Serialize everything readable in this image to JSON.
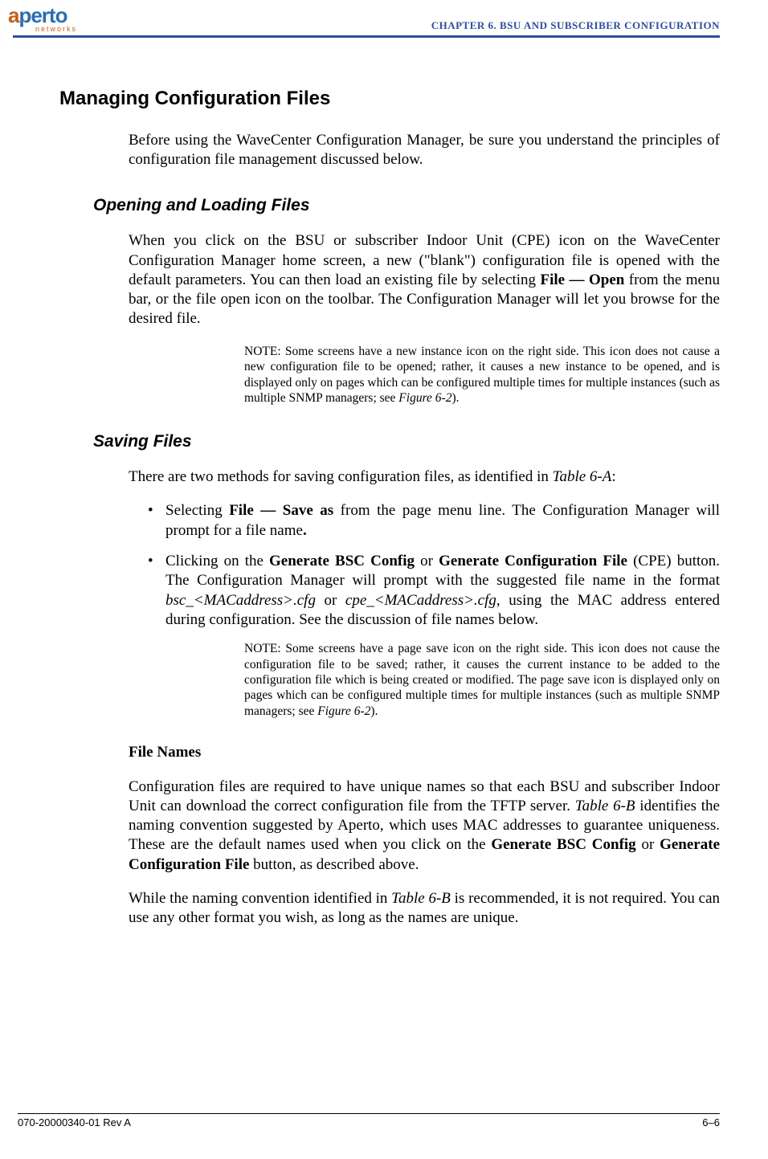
{
  "header": {
    "logo_primary": "a",
    "logo_rest": "perto",
    "logo_sub": "networks",
    "chapter_label": "CHAPTER 6.  BSU AND SUBSCRIBER CONFIGURATION"
  },
  "section": {
    "title": "Managing Configuration Files",
    "intro": "Before using the WaveCenter Configuration Manager, be sure you understand the principles of configuration file management discussed below."
  },
  "opening": {
    "heading": "Opening and Loading Files",
    "para_pre": "When you click on the BSU or subscriber Indoor Unit (CPE) icon on the WaveCenter Configuration Manager home screen, a new (\"blank\") configuration file is opened with the default parameters. You can then load an existing file by selecting ",
    "file_open": "File — Open",
    "para_post": " from the menu bar, or the file open icon on the toolbar. The Configuration Man­ager will let you browse for the desired file.",
    "note_pre": "NOTE:  Some screens have a new instance icon on the right side. This icon does not cause a new configuration file to be opened; rather, it causes a new instance to be opened, and is displayed only on pages which can be configured multiple times for multiple instances (such as multiple SNMP managers; see ",
    "note_ref": "Figure 6-2",
    "note_post": ")."
  },
  "saving": {
    "heading": "Saving Files",
    "intro_pre": "There are two methods for saving configuration files, as identified in ",
    "intro_ref": "Table 6-A",
    "intro_post": ":",
    "bullet1_pre": "Selecting ",
    "bullet1_bold": "File — Save as",
    "bullet1_post": " from the page menu line. The Configuration Manager will prompt for a file name",
    "bullet1_dot": ".",
    "bullet2_pre": "Clicking on the ",
    "bullet2_bold1": "Generate BSC Config",
    "bullet2_mid1": " or ",
    "bullet2_bold2": "Generate Configuration File",
    "bullet2_mid2": " (CPE) button. The Configuration Manager will prompt with the suggested file name in the format ",
    "bullet2_it1": "bsc_<MACaddress>.cfg",
    "bullet2_mid3": " or ",
    "bullet2_it2": "cpe_<MACaddress>.cfg",
    "bullet2_post": ", using the MAC address entered during configuration. See the discussion of file names below.",
    "note2_pre": "NOTE:  Some screens have a page save icon on the right side. This icon does not cause the configuration file to be saved; rather, it causes the current instance to be added to the configuration file which is being created or modified. The page save icon is displayed only on pages which can be configured multiple times for multiple instances (such as multiple SNMP managers; see ",
    "note2_ref": "Figure 6-2",
    "note2_post": ")."
  },
  "filenames": {
    "heading": "File Names",
    "p1_pre": "Configuration files are required to have unique names so that each BSU and sub­scriber Indoor Unit can download the correct configuration file from the TFTP server. ",
    "p1_ref": "Table 6-B",
    "p1_mid": " identifies the naming convention suggested by Aperto, which uses MAC addresses to guarantee uniqueness. These are the default names used when you click on the ",
    "p1_b1": "Generate BSC Config",
    "p1_or": " or ",
    "p1_b2": "Generate Configuration File",
    "p1_post": " button, as described above.",
    "p2_pre": "While the naming convention identified in ",
    "p2_ref": "Table 6-B",
    "p2_post": " is recommended, it is not required. You can use any other format you wish, as long as the names are unique."
  },
  "footer": {
    "doc_id": "070-20000340-01 Rev A",
    "page": "6–6"
  }
}
